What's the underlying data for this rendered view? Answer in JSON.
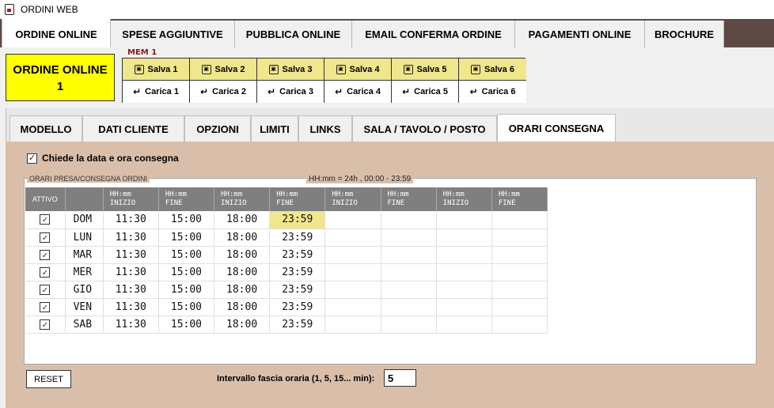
{
  "window": {
    "title": "ORDINI WEB"
  },
  "top_tabs": [
    {
      "label": "ORDINE ONLINE",
      "active": true
    },
    {
      "label": "SPESE AGGIUNTIVE",
      "active": false
    },
    {
      "label": "PUBBLICA ONLINE",
      "active": false
    },
    {
      "label": "EMAIL CONFERMA ORDINE",
      "active": false
    },
    {
      "label": "PAGAMENTI ONLINE",
      "active": false
    },
    {
      "label": "BROCHURE",
      "active": false
    }
  ],
  "order_box": {
    "line1": "ORDINE ONLINE",
    "line2": "1"
  },
  "memory": {
    "label": "MEM 1",
    "save": [
      "Salva 1",
      "Salva 2",
      "Salva 3",
      "Salva 4",
      "Salva 5",
      "Salva 6"
    ],
    "load": [
      "Carica 1",
      "Carica 2",
      "Carica 3",
      "Carica 4",
      "Carica 5",
      "Carica 6"
    ]
  },
  "sub_tabs": [
    {
      "label": "MODELLO",
      "active": false
    },
    {
      "label": "DATI CLIENTE",
      "active": false
    },
    {
      "label": "OPZIONI",
      "active": false
    },
    {
      "label": "LIMITI",
      "active": false
    },
    {
      "label": "LINKS",
      "active": false
    },
    {
      "label": "SALA / TAVOLO / POSTO",
      "active": false
    },
    {
      "label": "ORARI CONSEGNA",
      "active": true
    }
  ],
  "ask_date": {
    "label": "Chiede la data e ora consegna",
    "checked": true,
    "check_glyph": "✓"
  },
  "group": {
    "legend": "ORARI PRESA/CONSEGNA ORDINI",
    "hint": "HH:mm = 24h ,  00:00 - 23:59"
  },
  "table": {
    "attivo_header": "ATTIVO",
    "time_headers": [
      {
        "l1": "HH:mm",
        "l2": "INIZIO"
      },
      {
        "l1": "HH:mm",
        "l2": "FINE"
      },
      {
        "l1": "HH:mm",
        "l2": "INIZIO"
      },
      {
        "l1": "HH:mm",
        "l2": "FINE"
      },
      {
        "l1": "HH:mm",
        "l2": "INIZIO"
      },
      {
        "l1": "HH:mm",
        "l2": "FINE"
      },
      {
        "l1": "HH:mm",
        "l2": "INIZIO"
      },
      {
        "l1": "HH:mm",
        "l2": "FINE"
      }
    ],
    "rows": [
      {
        "day": "DOM",
        "active": true,
        "times": [
          "11:30",
          "15:00",
          "18:00",
          "23:59",
          "",
          "",
          "",
          ""
        ]
      },
      {
        "day": "LUN",
        "active": true,
        "times": [
          "11:30",
          "15:00",
          "18:00",
          "23:59",
          "",
          "",
          "",
          ""
        ]
      },
      {
        "day": "MAR",
        "active": true,
        "times": [
          "11:30",
          "15:00",
          "18:00",
          "23:59",
          "",
          "",
          "",
          ""
        ]
      },
      {
        "day": "MER",
        "active": true,
        "times": [
          "11:30",
          "15:00",
          "18:00",
          "23:59",
          "",
          "",
          "",
          ""
        ]
      },
      {
        "day": "GIO",
        "active": true,
        "times": [
          "11:30",
          "15:00",
          "18:00",
          "23:59",
          "",
          "",
          "",
          ""
        ]
      },
      {
        "day": "VEN",
        "active": true,
        "times": [
          "11:30",
          "15:00",
          "18:00",
          "23:59",
          "",
          "",
          "",
          ""
        ]
      },
      {
        "day": "SAB",
        "active": true,
        "times": [
          "11:30",
          "15:00",
          "18:00",
          "23:59",
          "",
          "",
          "",
          ""
        ]
      }
    ]
  },
  "reset": {
    "label": "RESET"
  },
  "interval": {
    "label": "Intervallo fascia oraria (1, 5, 15... min):",
    "value": "5"
  },
  "colors": {
    "accent_yellow": "#ffff00",
    "memory_yellow": "#f0e68c",
    "panel_tan": "#d9bfaa",
    "tabbar_brown": "#5e4a44",
    "header_gray": "#7f7f7f"
  }
}
